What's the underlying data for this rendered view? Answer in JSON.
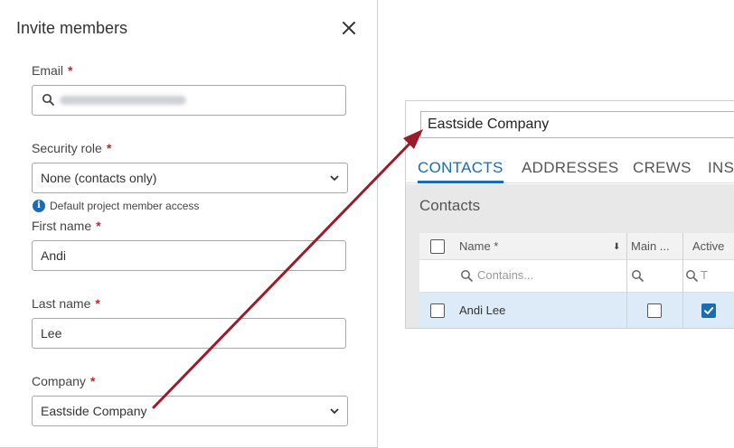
{
  "dialog": {
    "title": "Invite members",
    "close_icon": "close-icon",
    "fields": {
      "email": {
        "label": "Email",
        "required_mark": "*",
        "value": ""
      },
      "security_role": {
        "label": "Security role",
        "required_mark": "*",
        "value": "None (contacts only)"
      },
      "hint": "Default project member access",
      "first_name": {
        "label": "First name",
        "required_mark": "*",
        "value": "Andi"
      },
      "last_name": {
        "label": "Last name",
        "required_mark": "*",
        "value": "Lee"
      },
      "company": {
        "label": "Company",
        "required_mark": "*",
        "value": "Eastside Company"
      }
    }
  },
  "company_screen": {
    "name": "Eastside Company",
    "tabs": [
      {
        "label": "CONTACTS",
        "active": true
      },
      {
        "label": "ADDRESSES",
        "active": false
      },
      {
        "label": "CREWS",
        "active": false
      },
      {
        "label": "INS",
        "active": false
      }
    ],
    "section_title": "Contacts",
    "grid": {
      "columns": [
        "Name *",
        "Main ...",
        "Active"
      ],
      "filter_placeholder": "Contains...",
      "filter_partial": "T",
      "rows": [
        {
          "name": "Andi Lee",
          "main": false,
          "active": true
        }
      ]
    }
  },
  "colors": {
    "accent": "#1d6bb0",
    "required": "#c8232c",
    "arrow": "#9b1b2a",
    "selected_row": "#dcebf7"
  }
}
